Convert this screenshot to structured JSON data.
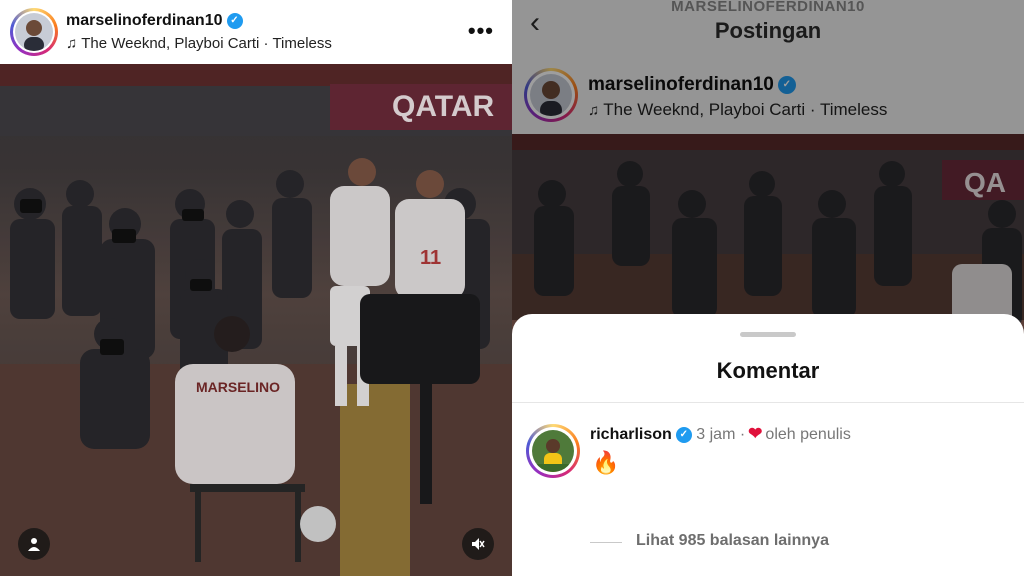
{
  "post": {
    "username": "marselinoferdinan10",
    "music": "The Weeknd, Playboi Carti · Timeless",
    "more_label": "•••",
    "jersey_text": "MARSELINO",
    "banner_text": "QATAR"
  },
  "right_header": {
    "subtitle": "MARSELINOFERDINAN10",
    "title": "Postingan"
  },
  "comments_sheet": {
    "title": "Komentar",
    "comment": {
      "username": "richarlison",
      "time": "3 jam",
      "liked_by_author": "oleh penulis",
      "text": "🔥"
    },
    "view_replies": "Lihat 985 balasan lainnya"
  },
  "colors": {
    "verified": "#1f9bf0",
    "heart": "#e0113b"
  },
  "icons": [
    "verified-badge-icon",
    "music-note-icon",
    "more-options-icon",
    "user-tag-icon",
    "mute-icon",
    "back-arrow-icon",
    "heart-icon"
  ]
}
